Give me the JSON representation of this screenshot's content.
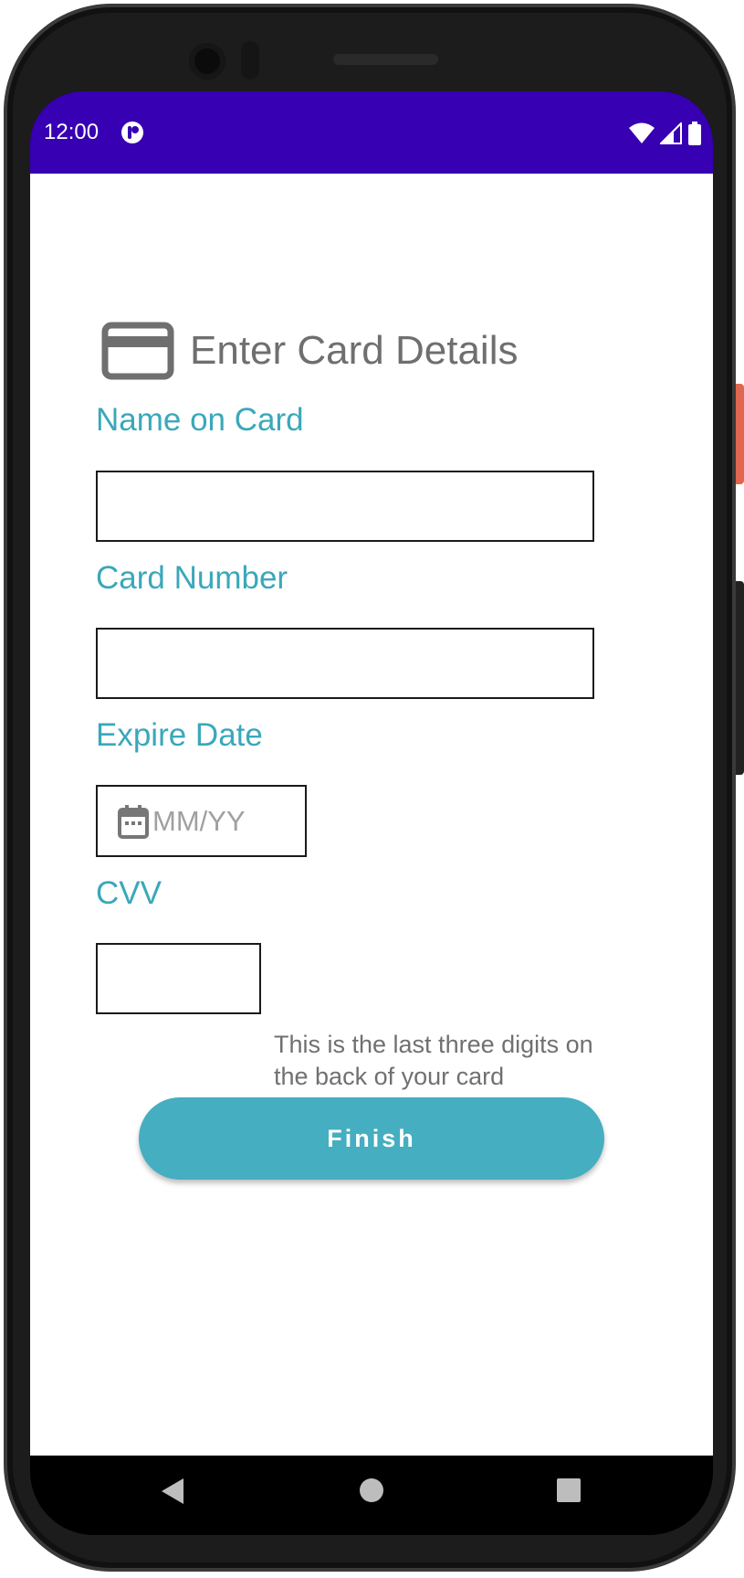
{
  "status_bar": {
    "time": "12:00",
    "app_icon": "notification-app-icon",
    "icons": [
      "wifi-icon",
      "cellular-signal-icon",
      "battery-icon"
    ],
    "background": "#3700b3"
  },
  "form": {
    "title": "Enter Card Details",
    "title_icon": "credit-card-icon",
    "name_label": "Name on Card",
    "name_value": "",
    "card_number_label": "Card Number",
    "card_number_value": "",
    "expire_label": "Expire Date",
    "expire_placeholder": "MM/YY",
    "expire_icon": "calendar-icon",
    "cvv_label": "CVV",
    "cvv_value": "",
    "cvv_help": "This is the last three digits on the back of your card",
    "finish_label": "Finish"
  },
  "nav_bar": {
    "buttons": [
      "back-icon",
      "home-icon",
      "recents-icon"
    ]
  },
  "colors": {
    "accent": "#45aec0",
    "label": "#3aa8ba",
    "title": "#6f6f6f",
    "status_bar": "#3700b3"
  }
}
